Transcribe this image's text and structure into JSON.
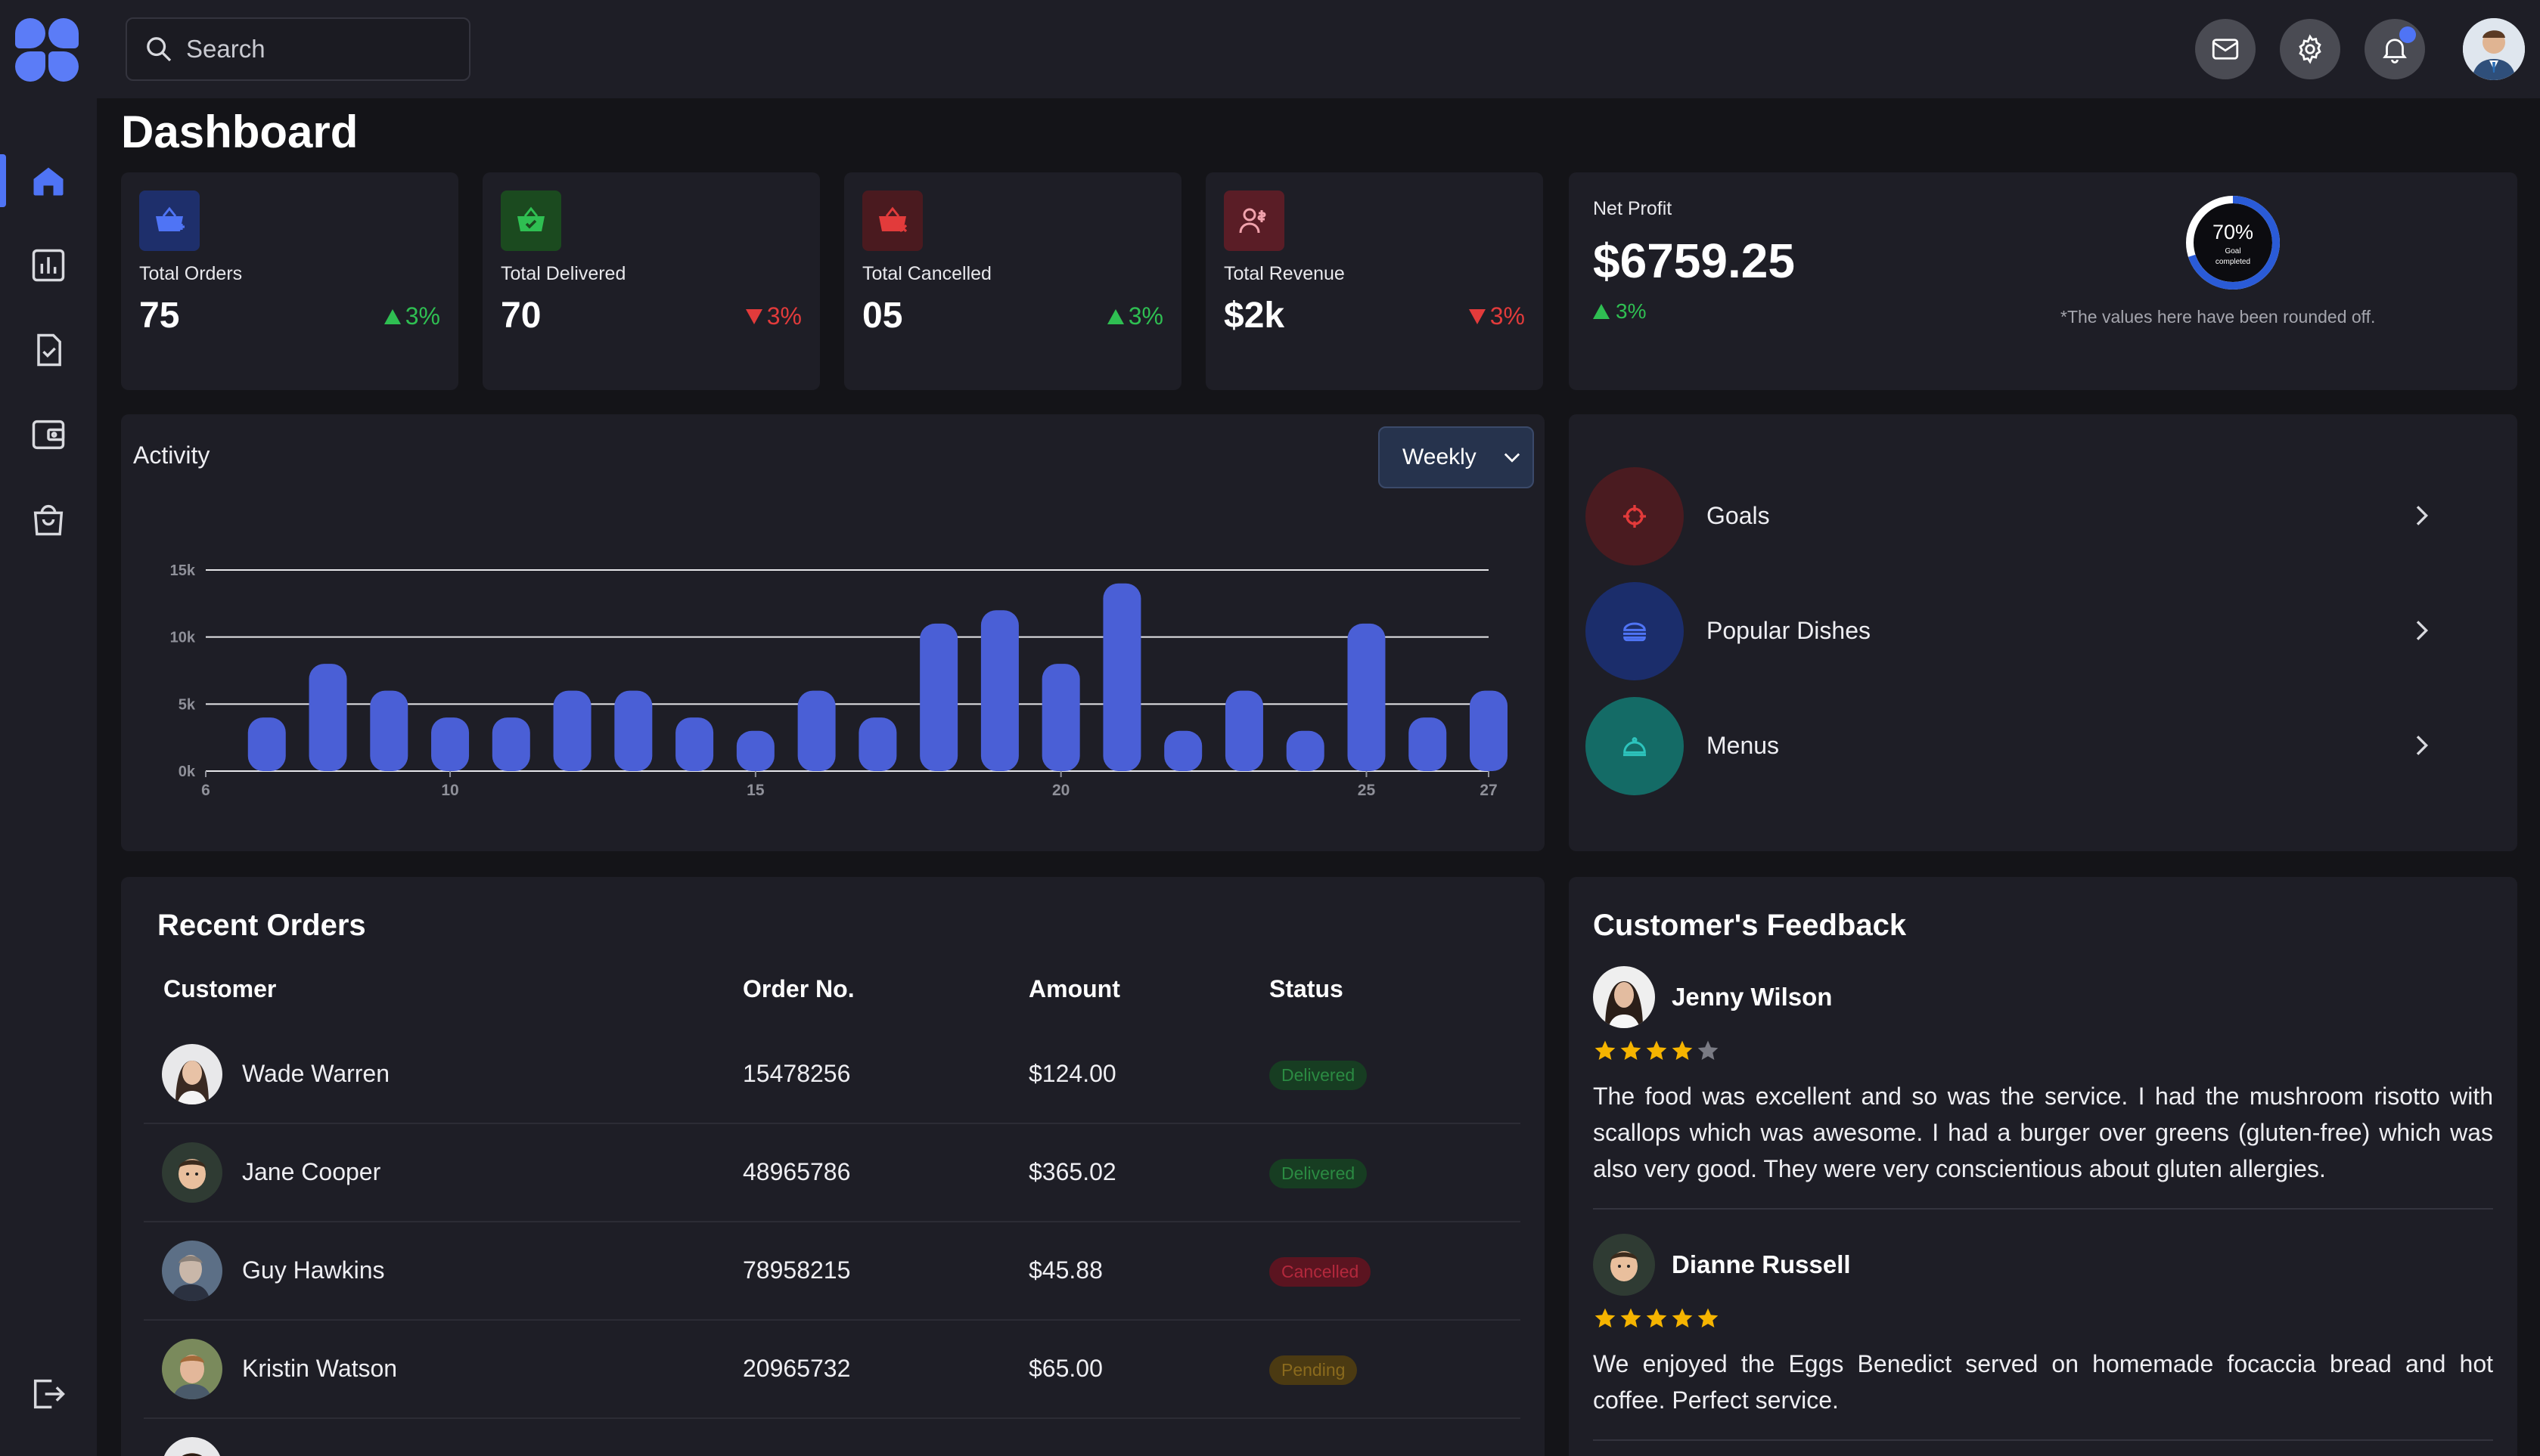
{
  "header": {
    "search_placeholder": "Search",
    "icons": [
      "mail-icon",
      "settings-icon",
      "bell-icon"
    ],
    "avatar": "user-avatar"
  },
  "sidebar": {
    "items": [
      "home-icon",
      "chart-icon",
      "checklist-icon",
      "wallet-icon",
      "shopping-bag-icon"
    ],
    "active": "home-icon",
    "bottom": "logout-icon"
  },
  "page": {
    "title": "Dashboard"
  },
  "stats": [
    {
      "label": "Total Orders",
      "value": "75",
      "delta": "3%",
      "direction": "up",
      "icon": "basket-add-icon",
      "color": "#1e2f6b"
    },
    {
      "label": "Total Delivered",
      "value": "70",
      "delta": "3%",
      "direction": "down",
      "icon": "basket-check-icon",
      "color": "#1b4a1f"
    },
    {
      "label": "Total Cancelled",
      "value": "05",
      "delta": "3%",
      "direction": "up",
      "icon": "basket-cancel-icon",
      "color": "#4a1a1f"
    },
    {
      "label": "Total Revenue",
      "value": "$2k",
      "delta": "3%",
      "direction": "down",
      "icon": "user-dollar-icon",
      "color": "#5a1d26"
    }
  ],
  "net_profit": {
    "label": "Net Profit",
    "value": "$6759.25",
    "delta": "3%",
    "goal_percent": "70%",
    "goal_fraction": 0.7,
    "goal_label": "Goal",
    "goal_sub": "completed",
    "note": "*The values here have been rounded off."
  },
  "activity": {
    "title": "Activity",
    "select_value": "Weekly"
  },
  "chart_data": {
    "type": "bar",
    "title": "Activity",
    "xlabel": "",
    "ylabel": "",
    "x": [
      7,
      8,
      9,
      10,
      11,
      12,
      13,
      14,
      15,
      16,
      17,
      18,
      19,
      20,
      21,
      22,
      23,
      24,
      25,
      26,
      27
    ],
    "values": [
      4000,
      8000,
      6000,
      4000,
      4000,
      6000,
      6000,
      4000,
      3000,
      6000,
      4000,
      11000,
      12000,
      8000,
      14000,
      3000,
      6000,
      3000,
      11000,
      4000,
      6000
    ],
    "xlim": [
      6,
      27
    ],
    "xticks": [
      "6",
      "10",
      "15",
      "20",
      "25",
      "27"
    ],
    "ylim": [
      0,
      15000
    ],
    "yticks": [
      "0k",
      "5k",
      "10k",
      "15k"
    ],
    "grid": true,
    "color": "#4a5fd6"
  },
  "quick_links": [
    {
      "label": "Goals",
      "icon": "target-icon",
      "color": "#4a1b20",
      "icon_color": "#e33a3a"
    },
    {
      "label": "Popular Dishes",
      "icon": "burger-icon",
      "color": "#1b2d6b",
      "icon_color": "#4f74f5"
    },
    {
      "label": "Menus",
      "icon": "cloche-icon",
      "color": "#146b66",
      "icon_color": "#2dc4bd"
    }
  ],
  "recent_orders": {
    "title": "Recent Orders",
    "columns": [
      "Customer",
      "Order No.",
      "Amount",
      "Status"
    ],
    "rows": [
      {
        "customer": "Wade Warren",
        "order_no": "15478256",
        "amount": "$124.00",
        "status": "Delivered"
      },
      {
        "customer": "Jane Cooper",
        "order_no": "48965786",
        "amount": "$365.02",
        "status": "Delivered"
      },
      {
        "customer": "Guy Hawkins",
        "order_no": "78958215",
        "amount": "$45.88",
        "status": "Cancelled"
      },
      {
        "customer": "Kristin Watson",
        "order_no": "20965732",
        "amount": "$65.00",
        "status": "Pending"
      }
    ]
  },
  "feedback": {
    "title": "Customer's Feedback",
    "items": [
      {
        "name": "Jenny Wilson",
        "rating": 4,
        "text": "The food was excellent and so was the service. I had the mushroom risotto with scallops which was awesome. I had a burger over greens (gluten-free) which was also very good. They were very conscientious about gluten allergies."
      },
      {
        "name": "Dianne Russell",
        "rating": 5,
        "text": "We enjoyed the Eggs Benedict served on homemade focaccia bread and hot coffee. Perfect service."
      }
    ]
  }
}
